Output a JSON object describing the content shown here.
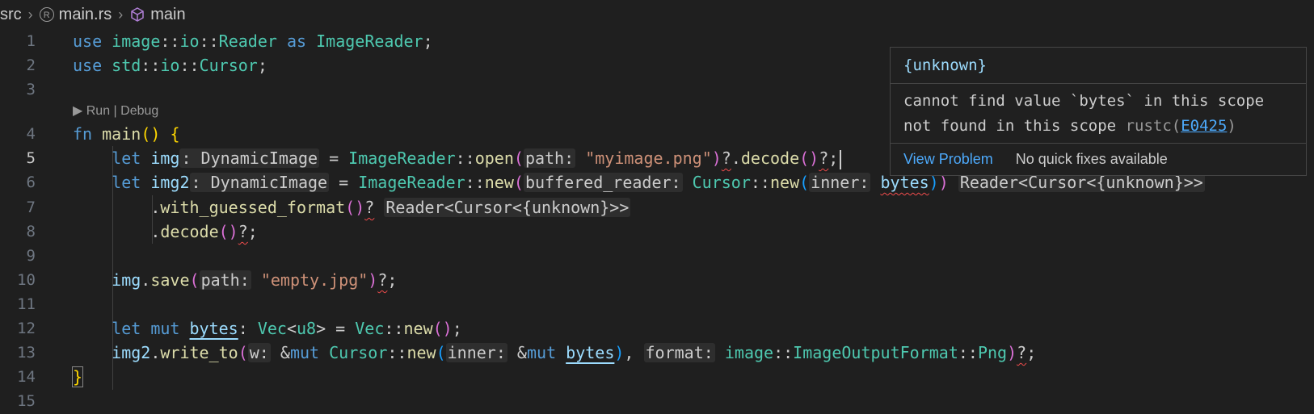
{
  "breadcrumb": {
    "folder": "src",
    "file": "main.rs",
    "symbol": "main",
    "file_icon": "rust-file-icon",
    "symbol_icon": "cube-symbol-icon"
  },
  "codelens": "▶ Run | Debug",
  "lines": {
    "l1": "1",
    "l2": "2",
    "l3": "3",
    "l4": "4",
    "l5": "5",
    "l6": "6",
    "l7": "7",
    "l8": "8",
    "l9": "9",
    "l10": "10",
    "l11": "11",
    "l12": "12",
    "l13": "13",
    "l14": "14",
    "l15": "15"
  },
  "hover": {
    "signature": "{unknown}",
    "message": "cannot find value `bytes` in this scope",
    "detail": "not found in this scope",
    "source": "rustc(",
    "code": "E0425",
    "source_close": ")",
    "view_problem": "View Problem",
    "no_fixes": "No quick fixes available"
  },
  "colors": {
    "keyword": "#569cd6",
    "type": "#4ec9b0",
    "function": "#dcdcaa",
    "variable": "#9cdcfe",
    "string": "#ce9178",
    "error": "#f14c4c",
    "link": "#4daafc"
  }
}
